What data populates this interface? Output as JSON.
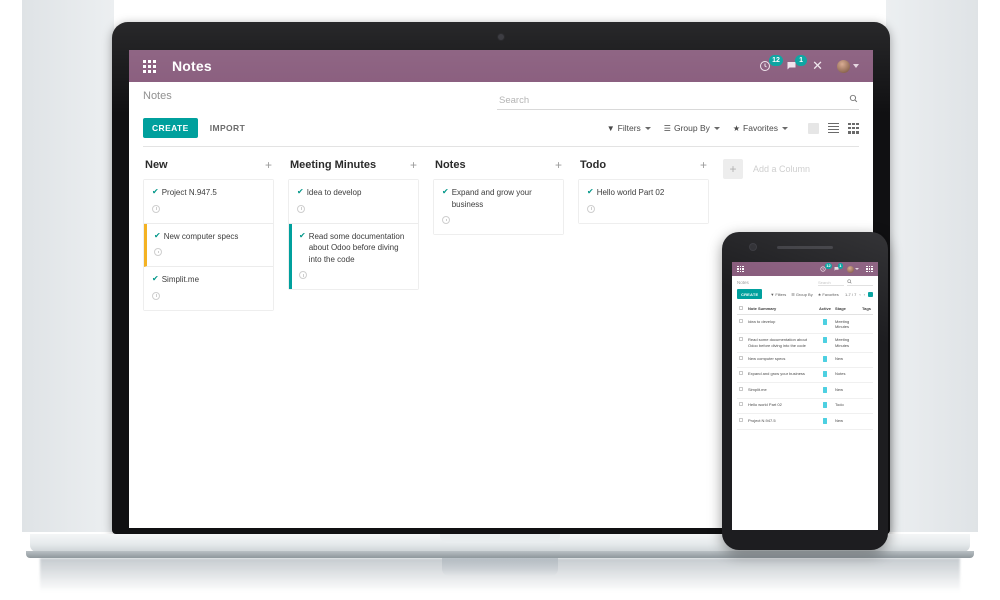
{
  "app": {
    "name": "Notes",
    "brand_color": "#875a7b",
    "accent_color": "#00a09d",
    "apps_menu_icon": "apps-grid-icon"
  },
  "topbar": {
    "title": "Notes",
    "activities": {
      "icon": "clock-activity-icon",
      "count": "12"
    },
    "messages": {
      "icon": "chat-bubble-icon",
      "count": "1"
    },
    "close": {
      "icon": "close-icon",
      "label": "✕"
    },
    "user": {
      "icon": "avatar-icon",
      "caret": "chevron-down-icon"
    }
  },
  "control_panel": {
    "breadcrumb": "Notes",
    "search": {
      "placeholder": "Search",
      "value": "",
      "icon": "search-icon"
    },
    "create_label": "CREATE",
    "import_label": "IMPORT",
    "filters": [
      {
        "label": "Filters",
        "icon": "filter-icon"
      },
      {
        "label": "Group By",
        "icon": "group-by-icon"
      },
      {
        "label": "Favorites",
        "icon": "star-icon"
      }
    ],
    "views": [
      {
        "name": "kanban-view",
        "active": true
      },
      {
        "name": "list-view",
        "active": false
      },
      {
        "name": "grid-view",
        "active": false
      }
    ]
  },
  "kanban": {
    "add_column": {
      "label": "Add a Column",
      "plus": "+"
    },
    "columns": [
      {
        "title": "New",
        "plus": "+",
        "cards": [
          {
            "title": "Project N.947.5",
            "check": "✔",
            "stripe": "none"
          },
          {
            "title": "New computer specs",
            "check": "✔",
            "stripe": "#f4b223"
          },
          {
            "title": "Simplit.me",
            "check": "✔",
            "stripe": "none"
          }
        ]
      },
      {
        "title": "Meeting Minutes",
        "plus": "+",
        "cards": [
          {
            "title": "Idea to develop",
            "check": "✔",
            "stripe": "none"
          },
          {
            "title": "Read some documentation about Odoo before diving into the code",
            "check": "✔",
            "stripe": "#00a09d"
          }
        ]
      },
      {
        "title": "Notes",
        "plus": "+",
        "cards": [
          {
            "title": "Expand and grow your business",
            "check": "✔",
            "stripe": "none"
          }
        ]
      },
      {
        "title": "Todo",
        "plus": "+",
        "cards": [
          {
            "title": "Hello world Part 02",
            "check": "✔",
            "stripe": "none"
          }
        ]
      }
    ]
  },
  "phone": {
    "topbar": {
      "apps_icon": "apps-grid-icon",
      "activities_count": "12",
      "messages_count": "1",
      "menu_icon": "menu-icon"
    },
    "control_panel": {
      "breadcrumb": "Notes",
      "search_placeholder": "Search",
      "create_label": "CREATE",
      "filters": [
        "Filters",
        "Group By",
        "Favorites"
      ],
      "pager": "1-7 / 7"
    },
    "table": {
      "columns": [
        "Note Summary",
        "Active",
        "Stage",
        "Tags"
      ],
      "rows": [
        {
          "summary": "Idea to develop",
          "active": true,
          "stage": "Meeting Minutes",
          "tags": ""
        },
        {
          "summary": "Read some documentation about Odoo before diving into the code",
          "active": true,
          "stage": "Meeting Minutes",
          "tags": ""
        },
        {
          "summary": "New computer specs",
          "active": true,
          "stage": "New",
          "tags": ""
        },
        {
          "summary": "Expand and grow your business",
          "active": true,
          "stage": "Notes",
          "tags": ""
        },
        {
          "summary": "Simplit.me",
          "active": true,
          "stage": "New",
          "tags": ""
        },
        {
          "summary": "Hello world Part 02",
          "active": true,
          "stage": "Todo",
          "tags": ""
        },
        {
          "summary": "Project N.947.5",
          "active": true,
          "stage": "New",
          "tags": ""
        }
      ]
    }
  }
}
